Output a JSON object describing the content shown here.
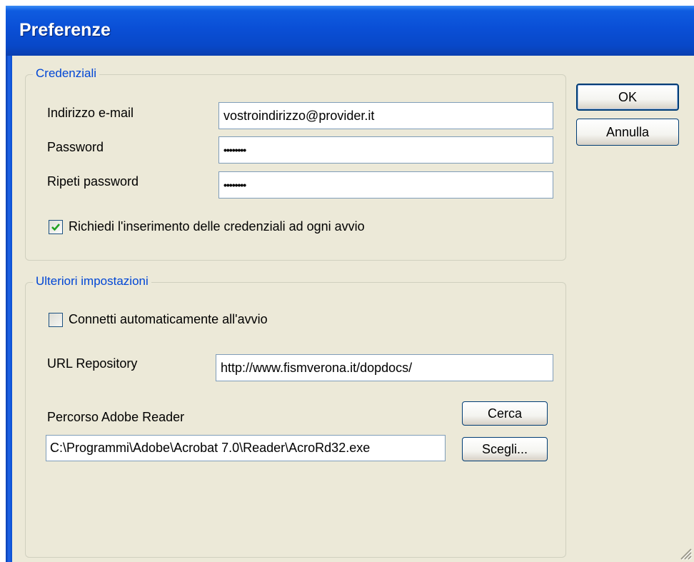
{
  "window": {
    "title": "Preferenze"
  },
  "credenziali": {
    "legend": "Credenziali",
    "email_label": "Indirizzo e-mail",
    "email_value": "vostroindirizzo@provider.it",
    "password_label": "Password",
    "password_value": "••••••••",
    "repeat_label": "Ripeti password",
    "repeat_value": "••••••••",
    "ask_label": "Richiedi l'inserimento delle credenziali ad ogni avvio",
    "ask_checked": true
  },
  "ulteriori": {
    "legend": "Ulteriori impostazioni",
    "autoconnect_label": "Connetti automaticamente all'avvio",
    "autoconnect_checked": false,
    "url_label": "URL Repository",
    "url_value": "http://www.fismverona.it/dopdocs/",
    "reader_label": "Percorso Adobe Reader",
    "reader_value": "C:\\Programmi\\Adobe\\Acrobat 7.0\\Reader\\AcroRd32.exe",
    "search_button": "Cerca",
    "choose_button": "Scegli..."
  },
  "buttons": {
    "ok": "OK",
    "cancel": "Annulla"
  },
  "colors": {
    "title_bar": "#0a4fd6",
    "legend_text": "#0046d5",
    "dialog_bg": "#ece9d8"
  },
  "icons": [
    "checkmark-icon",
    "resize-grip-icon"
  ]
}
